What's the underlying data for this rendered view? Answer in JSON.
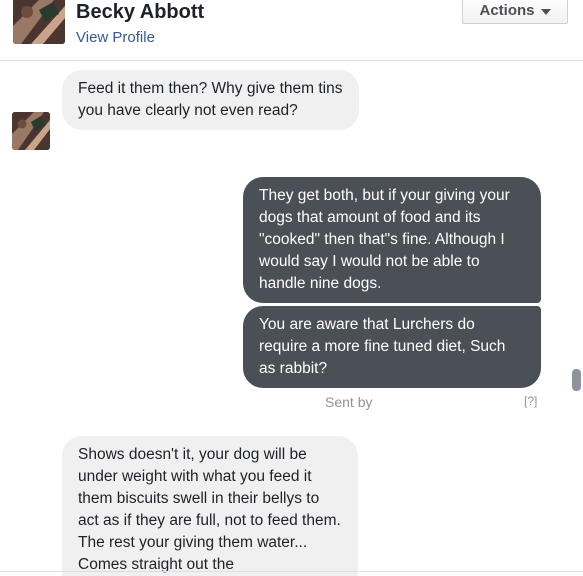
{
  "header": {
    "contact_name": "Becky Abbott",
    "profile_link": "View Profile",
    "actions_label": "Actions"
  },
  "messages": [
    {
      "direction": "incoming",
      "text": "Feed it them then? Why give them tins you have clearly not even read?"
    },
    {
      "direction": "outgoing",
      "text": "They get both, but if your giving your dogs that amount of food and its \"cooked\" then that\"s fine. Although I would say I would not be able to handle nine dogs."
    },
    {
      "direction": "outgoing",
      "text": "You are aware that Lurchers do require a more fine tuned diet, Such as rabbit?"
    },
    {
      "direction": "incoming",
      "text": "Shows doesn't it, your dog will be under weight with what you feed it them biscuits swell in their bellys to act as if they are full, not to feed them. The rest your giving them water... Comes straight out the"
    }
  ],
  "status": {
    "sent_text": "Sent by",
    "help_text": "[?]"
  },
  "icons": {
    "actions_caret": "chevron-down-icon",
    "avatar": "avatar"
  },
  "colors": {
    "incoming_bubble": "#f1f0f0",
    "outgoing_bubble": "#4b4f56",
    "link": "#365899"
  }
}
